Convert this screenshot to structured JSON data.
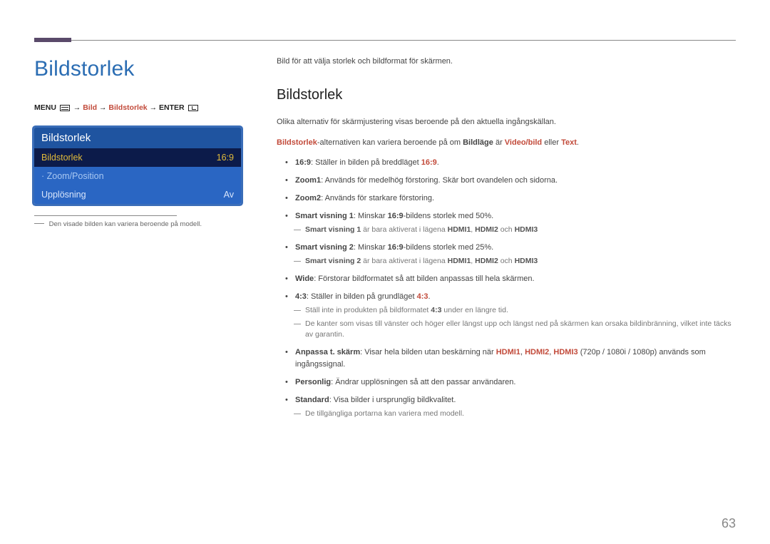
{
  "page_number": "63",
  "left": {
    "title": "Bildstorlek",
    "menupath_prefix": "MENU",
    "menupath_arrow": " → ",
    "menupath_bild": "Bild",
    "menupath_bildstorlek": "Bildstorlek",
    "menupath_enter": "ENTER",
    "osd": {
      "header": "Bildstorlek",
      "items": [
        {
          "label": "Bildstorlek",
          "value": "16:9",
          "style": "selected"
        },
        {
          "label": "·  Zoom/Position",
          "value": "",
          "style": "dim"
        },
        {
          "label": "Upplösning",
          "value": "Av",
          "style": "normal"
        }
      ]
    },
    "footnote": "Den visade bilden kan variera beroende på modell."
  },
  "right": {
    "intro": "Bild för att välja storlek och bildformat för skärmen.",
    "h2": "Bildstorlek",
    "p1": "Olika alternativ för skärmjustering visas beroende på den aktuella ingångskällan.",
    "p2_pre": "",
    "p2_b1": "Bildstorlek",
    "p2_mid": "-alternativen kan variera beroende på om ",
    "p2_b2": "Bildläge",
    "p2_mid2": " är ",
    "p2_r1": "Video/bild",
    "p2_mid3": " eller ",
    "p2_r2": "Text",
    "p2_end": ".",
    "bullets": [
      {
        "b": "16:9",
        "t": ": Ställer in bilden på breddläget ",
        "r": "16:9",
        "t2": "."
      },
      {
        "b": "Zoom1",
        "t": ": Används för medelhög förstoring. Skär bort ovandelen och sidorna."
      },
      {
        "b": "Zoom2",
        "t": ": Används för starkare förstoring."
      },
      {
        "b": "Smart visning 1",
        "t": ": Minskar ",
        "b2": "16:9",
        "t2": "-bildens storlek med 50%.",
        "note": {
          "pre": "",
          "b1": "Smart visning 1",
          "mid": " är bara aktiverat i lägena ",
          "r1": "HDMI1",
          "c1": ", ",
          "r2": "HDMI2",
          "c2": " och ",
          "r3": "HDMI3"
        }
      },
      {
        "b": "Smart visning 2",
        "t": ": Minskar ",
        "b2": "16:9",
        "t2": "-bildens storlek med 25%.",
        "note": {
          "pre": "",
          "b1": "Smart visning 2",
          "mid": " är bara aktiverat i lägena ",
          "r1": "HDMI1",
          "c1": ", ",
          "r2": "HDMI2",
          "c2": " och ",
          "r3": "HDMI3"
        }
      },
      {
        "b": "Wide",
        "t": ": Förstorar bildformatet så att bilden anpassas till hela skärmen."
      },
      {
        "b": "4:3",
        "t": ": Ställer in bilden på grundläget ",
        "r": "4:3",
        "t2": ".",
        "note2": [
          {
            "pre": "Ställ inte in produkten på bildformatet ",
            "b": "4:3",
            "post": " under en längre tid."
          },
          {
            "plain": "De kanter som visas till vänster och höger eller längst upp och längst ned på skärmen kan orsaka bildinbränning, vilket inte täcks av garantin."
          }
        ]
      },
      {
        "b": "Anpassa t. skärm",
        "t": ": Visar hela bilden utan beskärning när ",
        "r": "HDMI1",
        "c1": ", ",
        "r2": "HDMI2",
        "c2": ", ",
        "r3": "HDMI3",
        "t2": " (720p / 1080i / 1080p) används som ingångssignal."
      },
      {
        "b": "Personlig",
        "t": ": Ändrar upplösningen så att den passar användaren."
      },
      {
        "b": "Standard",
        "t": ": Visa bilder i ursprunglig bildkvalitet.",
        "note3": "De tillgängliga portarna kan variera med modell."
      }
    ]
  }
}
